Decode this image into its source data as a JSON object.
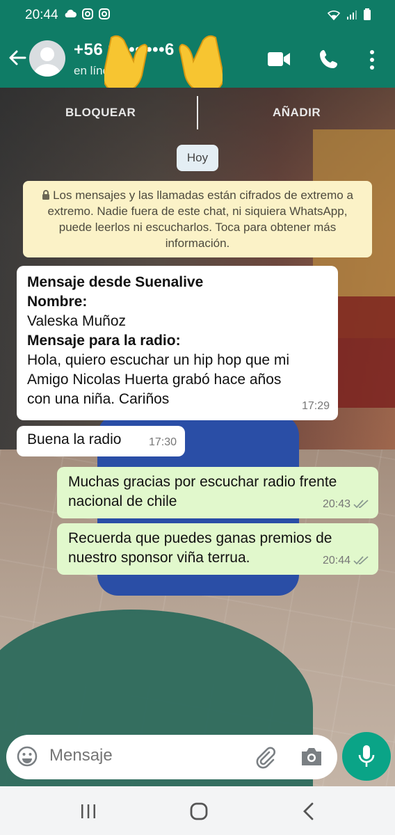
{
  "status_bar": {
    "time": "20:44"
  },
  "header": {
    "contact_name": "+56 9 ••• •••6",
    "contact_status": "en línea"
  },
  "actions": {
    "block_label": "BLOQUEAR",
    "add_label": "AÑADIR"
  },
  "date_chip": "Hoy",
  "encryption_notice": "Los mensajes y las llamadas están cifrados de extremo a extremo. Nadie fuera de este chat, ni siquiera WhatsApp, puede leerlos ni escucharlos. Toca para obtener más información.",
  "messages": [
    {
      "direction": "incoming",
      "lines": [
        {
          "text": "Mensaje desde Suenalive",
          "bold": true
        },
        {
          "text": "Nombre:",
          "bold": true
        },
        {
          "text": "Valeska Muñoz",
          "bold": false
        },
        {
          "text": "Mensaje para la radio:",
          "bold": true
        },
        {
          "text": "Hola, quiero escuchar un hip hop que mi",
          "bold": false
        },
        {
          "text": "Amigo Nicolas Huerta grabó hace años",
          "bold": false
        },
        {
          "text": "con una niña. Cariños",
          "bold": false
        }
      ],
      "time": "17:29"
    },
    {
      "direction": "incoming",
      "text": "Buena la radio",
      "time": "17:30"
    },
    {
      "direction": "outgoing",
      "text": "Muchas gracias por escuchar radio frente nacional de chile",
      "time": "20:43",
      "status": "read"
    },
    {
      "direction": "outgoing",
      "text": "Recuerda que puedes ganas premios de nuestro sponsor viña terrua.",
      "time": "20:44",
      "status": "read"
    }
  ],
  "composer": {
    "placeholder": "Mensaje"
  },
  "colors": {
    "header": "#0f7c66",
    "accent": "#0aa487",
    "outgoing_bubble": "#e1f8cc",
    "notice": "#fbf2c7"
  },
  "icons": [
    "back-arrow-icon",
    "video-call-icon",
    "phone-icon",
    "more-vert-icon",
    "lock-icon",
    "emoji-icon",
    "attach-icon",
    "camera-icon",
    "mic-icon",
    "double-check-icon"
  ]
}
